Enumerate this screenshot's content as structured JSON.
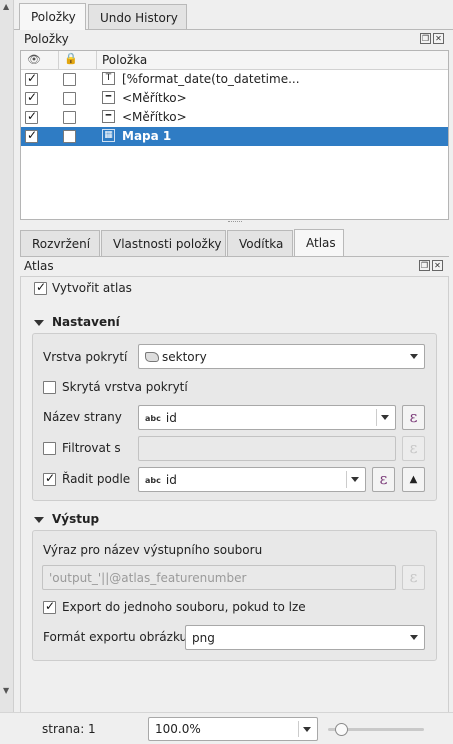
{
  "top_tabs": [
    "Položky",
    "Undo History"
  ],
  "items_panel": {
    "title": "Položky",
    "column_item": "Položka",
    "rows": [
      {
        "label": "[%format_date(to_datetime...",
        "icon": "text-label-icon",
        "visible": true,
        "locked": false,
        "selected": false
      },
      {
        "label": "<Měřítko>",
        "icon": "scalebar-icon",
        "visible": true,
        "locked": false,
        "selected": false
      },
      {
        "label": "<Měřítko>",
        "icon": "scalebar-icon",
        "visible": true,
        "locked": false,
        "selected": false
      },
      {
        "label": "Mapa 1",
        "icon": "map-icon",
        "visible": true,
        "locked": false,
        "selected": true
      }
    ]
  },
  "mid_tabs": [
    "Rozvržení",
    "Vlastnosti položky",
    "Vodítka",
    "Atlas"
  ],
  "atlas_panel": {
    "title": "Atlas",
    "generate_atlas": {
      "label": "Vytvořit atlas",
      "checked": true
    },
    "settings": {
      "title": "Nastavení",
      "coverage_layer_label": "Vrstva pokrytí",
      "coverage_layer_value": "sektory",
      "hidden_coverage_label": "Skrytá vrstva pokrytí",
      "hidden_coverage_checked": false,
      "page_name_label": "Název strany",
      "page_name_value": "id",
      "filter_label": "Filtrovat s",
      "filter_checked": false,
      "sort_label": "Řadit podle",
      "sort_checked": true,
      "sort_value": "id",
      "expr_symbol": "ε",
      "abc_tag": "abc"
    },
    "output": {
      "title": "Výstup",
      "filename_expr_label": "Výraz pro název výstupního souboru",
      "filename_expr_value": "'output_'||@atlas_featurenumber",
      "single_file_label": "Export do jednoho souboru, pokud to lze",
      "single_file_checked": true,
      "image_format_label": "Formát exportu obrázku",
      "image_format_value": "png"
    }
  },
  "status": {
    "page_label": "strana: 1",
    "zoom_value": "100.0%",
    "zoom_slider_fraction": 0.08
  }
}
